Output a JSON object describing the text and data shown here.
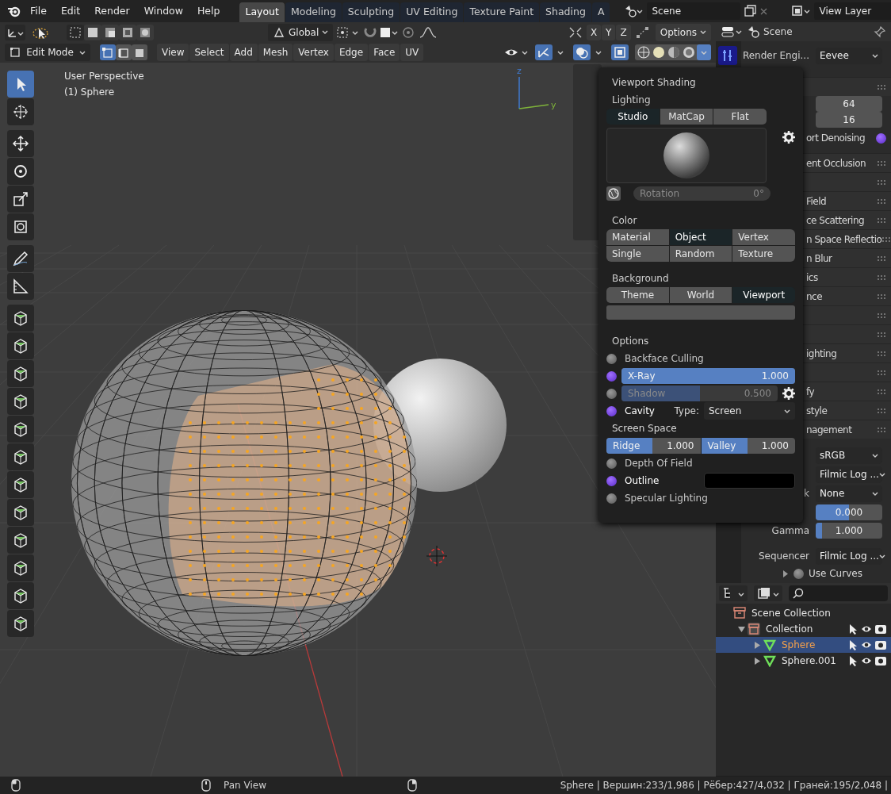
{
  "top_bar": {
    "menus": [
      "File",
      "Edit",
      "Render",
      "Window",
      "Help"
    ],
    "workspace_tabs": [
      {
        "label": "Layout",
        "selected": true
      },
      {
        "label": "Modeling",
        "selected": false
      },
      {
        "label": "Sculpting",
        "selected": false
      },
      {
        "label": "UV Editing",
        "selected": false
      },
      {
        "label": "Texture Paint",
        "selected": false
      },
      {
        "label": "Shading",
        "selected": false
      },
      {
        "label": "A",
        "selected": false
      }
    ],
    "scene": "Scene",
    "view_layer": "View Layer"
  },
  "tool_header": {
    "orientation": "Global",
    "mirror_axes": [
      "X",
      "Y",
      "Z"
    ],
    "options": "Options"
  },
  "editor_header": {
    "mode": "Edit Mode",
    "select_modes": [
      {
        "selected": true
      },
      {
        "selected": false
      },
      {
        "selected": false
      }
    ],
    "menus": [
      "View",
      "Select",
      "Add",
      "Mesh",
      "Vertex",
      "Edge",
      "Face",
      "UV"
    ]
  },
  "toolbar": {
    "tool_groups": [
      [
        {
          "selected": true
        },
        {
          "selected": false
        }
      ],
      [
        {
          "selected": false
        },
        {
          "selected": false
        },
        {
          "selected": false
        },
        {
          "selected": false
        }
      ],
      [
        {
          "selected": false
        },
        {
          "selected": false
        }
      ],
      [
        {
          "selected": false
        },
        {
          "selected": false
        },
        {
          "selected": false
        },
        {
          "selected": false
        },
        {
          "selected": false
        },
        {
          "selected": false
        },
        {
          "selected": false
        },
        {
          "selected": false
        },
        {
          "selected": false
        },
        {
          "selected": false
        },
        {
          "selected": false
        },
        {
          "selected": false
        }
      ]
    ]
  },
  "viewport": {
    "overlay_text": [
      "User Perspective",
      "(1) Sphere"
    ],
    "gizmo_axes": [
      "z",
      "y"
    ]
  },
  "shading_popover": {
    "title": "Viewport Shading",
    "lighting": {
      "label": "Lighting",
      "options": [
        {
          "label": "Studio",
          "selected": true
        },
        {
          "label": "MatCap",
          "selected": false
        },
        {
          "label": "Flat",
          "selected": false
        }
      ],
      "rotation_label": "Rotation",
      "rotation_value": "0°"
    },
    "color": {
      "label": "Color",
      "options": [
        {
          "label": "Material",
          "selected": false
        },
        {
          "label": "Object",
          "selected": true
        },
        {
          "label": "Vertex",
          "selected": false
        },
        {
          "label": "Single",
          "selected": false
        },
        {
          "label": "Random",
          "selected": false
        },
        {
          "label": "Texture",
          "selected": false
        }
      ]
    },
    "background": {
      "label": "Background",
      "options": [
        {
          "label": "Theme",
          "selected": false
        },
        {
          "label": "World",
          "selected": false
        },
        {
          "label": "Viewport",
          "selected": true
        }
      ]
    },
    "options": {
      "label": "Options",
      "rows": [
        {
          "kind": "toggle",
          "label": "Backface Culling",
          "checked": false
        },
        {
          "kind": "slider",
          "label": "X-Ray",
          "checked": true,
          "level": 1,
          "reading": "1.000"
        },
        {
          "kind": "slider_gear",
          "label": "Shadow",
          "checked": false,
          "level": 0.5,
          "reading": "0.500"
        },
        {
          "kind": "toggle_type",
          "label": "Cavity",
          "checked": true,
          "type_label": "Type:",
          "type_value": "Screen"
        },
        {
          "kind": "heading",
          "label": "Screen Space"
        },
        {
          "kind": "pair",
          "sliders": [
            {
              "label": "Ridge",
              "level": 0.49,
              "reading": "1.000"
            },
            {
              "label": "Valley",
              "level": 0.49,
              "reading": "1.000"
            }
          ]
        },
        {
          "kind": "toggle",
          "label": "Depth Of Field",
          "checked": false
        },
        {
          "kind": "toggle_swatch",
          "label": "Outline",
          "checked": true
        },
        {
          "kind": "toggle",
          "label": "Specular Lighting",
          "checked": false
        }
      ]
    }
  },
  "properties": {
    "title": "Scene",
    "render_engine": {
      "label": "Render Engi...",
      "value": "Eevee"
    },
    "rows": [
      {
        "kind": "section"
      },
      {
        "kind": "number",
        "value": "64"
      },
      {
        "kind": "number",
        "value": "16"
      },
      {
        "kind": "check",
        "text": "ort Denoising",
        "checked": true
      },
      {
        "kind": "section",
        "text": "ent Occlusion"
      },
      {
        "kind": "section"
      },
      {
        "kind": "section",
        "text": "Field"
      },
      {
        "kind": "section",
        "text": "ce Scattering"
      },
      {
        "kind": "section",
        "text": "n Space Reflectio"
      },
      {
        "kind": "section",
        "text": "n Blur"
      },
      {
        "kind": "section",
        "text": "ics"
      },
      {
        "kind": "section",
        "text": "nce"
      },
      {
        "kind": "section"
      },
      {
        "kind": "section"
      },
      {
        "kind": "section",
        "text": "ighting"
      },
      {
        "kind": "section"
      },
      {
        "kind": "section",
        "text": "fy"
      },
      {
        "kind": "section",
        "text": "style"
      },
      {
        "kind": "section",
        "text": "nagement"
      },
      {
        "kind": "dropdown",
        "value": "sRGB"
      },
      {
        "kind": "dropdown",
        "value": "Filmic Log ..."
      },
      {
        "kind": "dropdown",
        "text": "k",
        "value": "None"
      },
      {
        "kind": "slider",
        "value": "0.000",
        "level": 0.5
      },
      {
        "kind": "slider",
        "text": "Gamma",
        "value": "1.000",
        "level": 0.09
      },
      {
        "kind": "dropdown",
        "text": "Sequencer",
        "value": "Filmic Log ..."
      },
      {
        "kind": "subsection",
        "text": "Use Curves",
        "checked": false
      }
    ]
  },
  "outliner": {
    "items": [
      {
        "label": "Scene Collection",
        "kind": "scene_collection",
        "selected": false,
        "children": [
          {
            "label": "Collection",
            "kind": "collection",
            "selected": false,
            "expanded": true,
            "children": [
              {
                "label": "Sphere",
                "kind": "mesh",
                "selected": true,
                "expanded": false
              },
              {
                "label": "Sphere.001",
                "kind": "mesh",
                "selected": false,
                "expanded": false
              }
            ]
          }
        ]
      }
    ]
  },
  "status_bar": {
    "hints": [
      "Pan View"
    ],
    "stats": "Sphere | Вершин:233/1,986 | Рёбер:427/4,032 | Граней:195/2,048 |"
  }
}
